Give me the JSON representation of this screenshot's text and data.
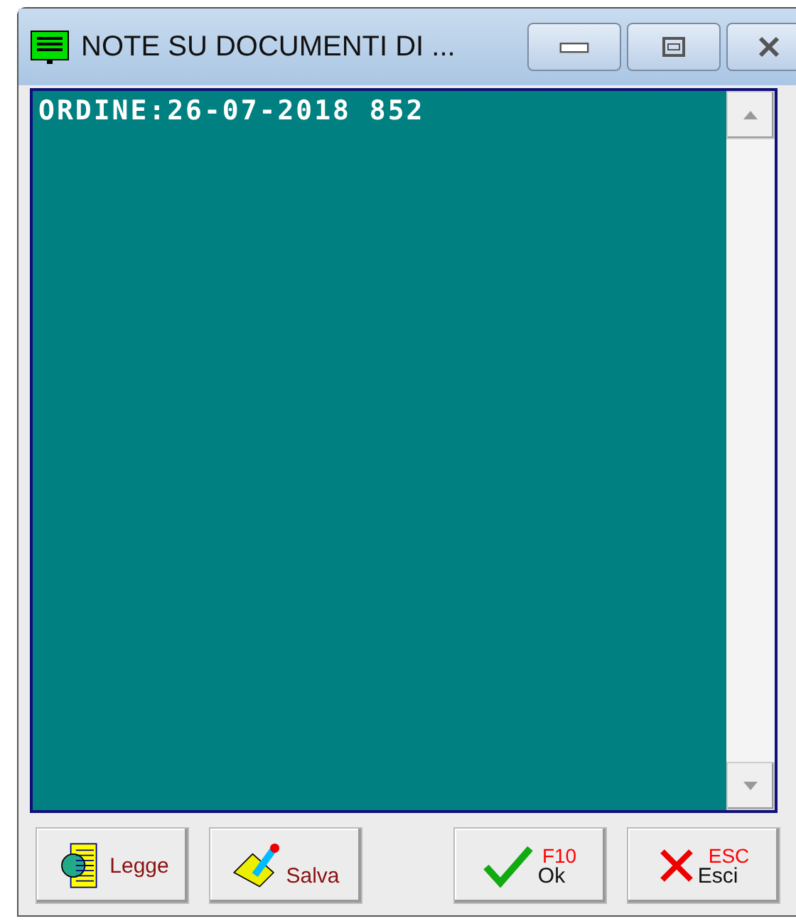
{
  "window": {
    "title": "NOTE SU DOCUMENTI DI ..."
  },
  "note": {
    "value": "ORDINE:26-07-2018 852"
  },
  "buttons": [
    {
      "kind": "read",
      "label": "Legge"
    },
    {
      "kind": "save",
      "label": "Salva"
    },
    {
      "kind": "ok",
      "label": "Ok",
      "hotkey": "F10"
    },
    {
      "kind": "exit",
      "label": "Esci",
      "hotkey": "ESC"
    }
  ]
}
